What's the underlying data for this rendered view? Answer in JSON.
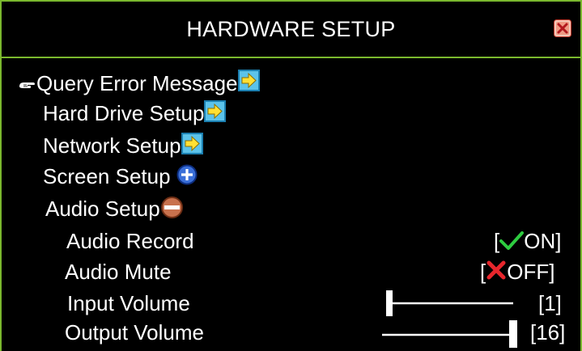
{
  "window": {
    "title": "HARDWARE SETUP"
  },
  "menu": {
    "items": [
      {
        "label": "Query Error Message",
        "icon": "arrow-right-icon",
        "selected": true
      },
      {
        "label": "Hard Drive Setup",
        "icon": "arrow-right-icon"
      },
      {
        "label": "Network Setup",
        "icon": "arrow-right-icon"
      },
      {
        "label": "Screen Setup",
        "icon": "expand-plus-icon"
      },
      {
        "label": "Audio Setup",
        "icon": "collapse-minus-icon"
      }
    ],
    "audio": {
      "record_label": "Audio Record",
      "record_bracket_open": "[",
      "record_value": "ON]",
      "mute_label": "Audio Mute",
      "mute_bracket_open": "[",
      "mute_value": "OFF]",
      "input_volume_label": "Input Volume",
      "input_volume_value": "[1]",
      "input_volume_level": 1,
      "output_volume_label": "Output Volume",
      "output_volume_value": "[16]",
      "output_volume_level": 16,
      "volume_max": 16
    }
  },
  "colors": {
    "border": "#7ab82e",
    "check": "#2ecc40",
    "cross": "#e8262c"
  }
}
